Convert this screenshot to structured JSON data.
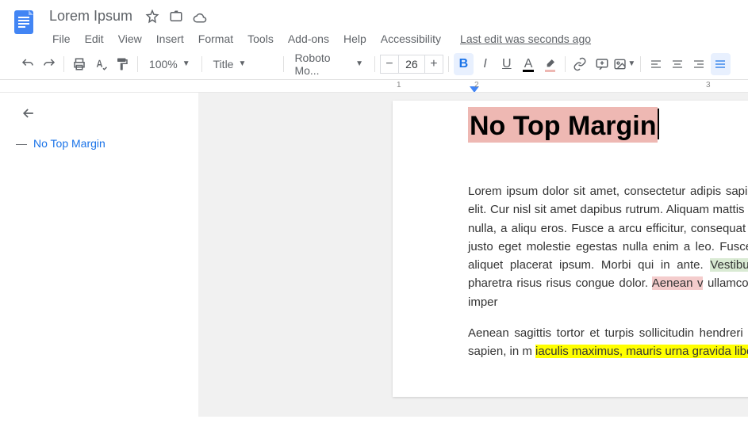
{
  "header": {
    "doc_title": "Lorem Ipsum",
    "last_edit": "Last edit was seconds ago"
  },
  "menus": [
    "File",
    "Edit",
    "View",
    "Insert",
    "Format",
    "Tools",
    "Add-ons",
    "Help",
    "Accessibility"
  ],
  "toolbar": {
    "zoom": "100%",
    "style": "Title",
    "font": "Roboto Mo...",
    "font_size": "26"
  },
  "outline": {
    "item1": "No Top Margin"
  },
  "ruler": {
    "n1": "1",
    "n2": "2",
    "n3": "3"
  },
  "content": {
    "title_part1": "No",
    "title_part2": " Top ",
    "title_part3": "Margin",
    "p1a": "Lorem ipsum dolor sit amet, consectetur adipis sapien facilisis commodo. Nulla at lacinia elit. Cur nisl sit amet dapibus rutrum. Aliquam mattis d ullamcorper. Duis consequat dictum nulla, a aliqu eros. Fusce a arcu efficitur, consequat massa et, et commodo. Morbi mollis, justo eget molestie egestas nulla enim a leo. Fusce rhoncus facilisis a magna sit amet, aliquet placerat ipsum. Morbi qui in ante. ",
    "p1_green": "Vestibulum maximus",
    "p1b": ", neque at faucibus p pharetra risus risus congue dolor. ",
    "p1_pink": "Aenean v",
    "p1c": " ullamcorper ex. Nunc sed facilisis nibh, vitae imper",
    "p2a": "Aenean sagittis tortor et turpis sollicitudin hendreri facilisis tincidunt. Sed eu malesuada sapien, in m ",
    "p2_yellow": "iaculis maximus, mauris urna gravida libero, s"
  }
}
